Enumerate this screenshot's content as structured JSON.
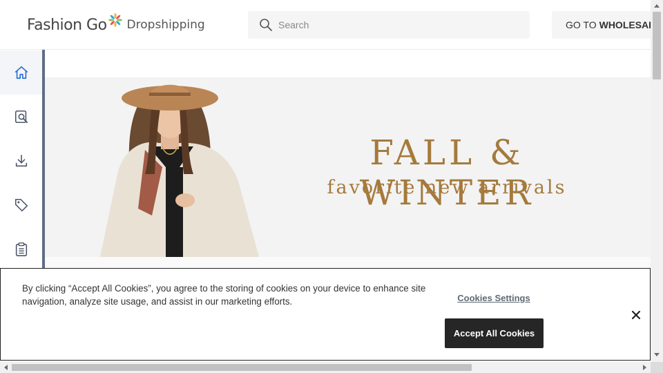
{
  "header": {
    "logo_text": "Fashion Go",
    "logo_sub": "Dropshipping",
    "search_placeholder": "Search",
    "wholesale_prefix": "GO TO",
    "wholesale_strong": "WHOLESALE"
  },
  "sidebar": {
    "items": [
      {
        "icon": "home-icon",
        "active": true
      },
      {
        "icon": "search-document-icon",
        "active": false
      },
      {
        "icon": "download-icon",
        "active": false
      },
      {
        "icon": "tag-icon",
        "active": false
      },
      {
        "icon": "clipboard-icon",
        "active": false
      }
    ]
  },
  "banner": {
    "title": "FALL & WINTER",
    "subtitle": "favorite new arrivals"
  },
  "cookie_banner": {
    "message": "By clicking “Accept All Cookies”, you agree to the storing of cookies on your device to enhance site navigation, analyze site usage, and assist in our marketing efforts.",
    "settings_label": "Cookies Settings",
    "accept_label": "Accept All Cookies"
  },
  "colors": {
    "accent_gold": "#a57a3c",
    "active_icon": "#2c6fd6",
    "sidebar_border": "#5f6d86",
    "accept_button": "#262626"
  }
}
